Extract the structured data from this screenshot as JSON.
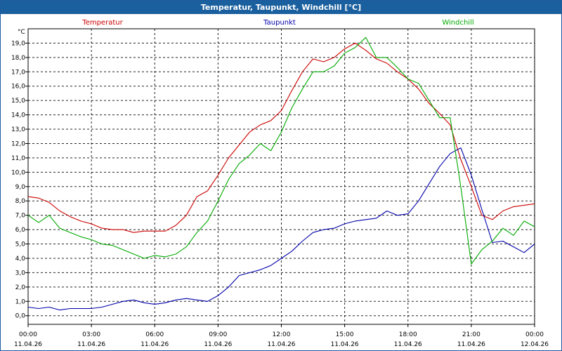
{
  "window": {
    "title": "Temperatur, Taupunkt, Windchill [°C]"
  },
  "colors": {
    "temperatur": "#cc0000",
    "taupunkt": "#0000aa",
    "windchill": "#00aa00",
    "titlebar": "#1a5f9e"
  },
  "chart_data": {
    "type": "line",
    "title": "Temperatur, Taupunkt, Windchill [°C]",
    "ylabel": "°C",
    "ylim": [
      -0.6,
      20.0
    ],
    "xlim": [
      "11.04.26 00:00",
      "12.04.26 00:00"
    ],
    "grid": true,
    "legend_placement": "top",
    "y_ticks": [
      "0,0",
      "1,0",
      "2,0",
      "3,0",
      "4,0",
      "5,0",
      "6,0",
      "7,0",
      "8,0",
      "9,0",
      "10,0",
      "11,0",
      "12,0",
      "13,0",
      "14,0",
      "15,0",
      "16,0",
      "17,0",
      "18,0",
      "19,0"
    ],
    "x_ticks": [
      {
        "time": "00:00",
        "date": "11.04.26"
      },
      {
        "time": "03:00",
        "date": "11.04.26"
      },
      {
        "time": "06:00",
        "date": "11.04.26"
      },
      {
        "time": "09:00",
        "date": "11.04.26"
      },
      {
        "time": "12:00",
        "date": "11.04.26"
      },
      {
        "time": "15:00",
        "date": "11.04.26"
      },
      {
        "time": "18:00",
        "date": "11.04.26"
      },
      {
        "time": "21:00",
        "date": "11.04.26"
      },
      {
        "time": "00:00",
        "date": "12.04.26"
      }
    ],
    "x": [
      "00:00",
      "00:30",
      "01:00",
      "01:30",
      "02:00",
      "02:30",
      "03:00",
      "03:30",
      "04:00",
      "04:30",
      "05:00",
      "05:30",
      "06:00",
      "06:30",
      "07:00",
      "07:30",
      "08:00",
      "08:30",
      "09:00",
      "09:30",
      "10:00",
      "10:30",
      "11:00",
      "11:30",
      "12:00",
      "12:30",
      "13:00",
      "13:30",
      "14:00",
      "14:30",
      "15:00",
      "15:30",
      "16:00",
      "16:30",
      "17:00",
      "17:30",
      "18:00",
      "18:30",
      "19:00",
      "19:30",
      "20:00",
      "20:30",
      "21:00",
      "21:30",
      "22:00",
      "22:30",
      "23:00",
      "23:30",
      "00:00"
    ],
    "series": [
      {
        "name": "Temperatur",
        "color": "#cc0000",
        "values": [
          8.3,
          8.2,
          7.9,
          7.3,
          6.9,
          6.6,
          6.4,
          6.1,
          6.0,
          6.0,
          5.8,
          5.9,
          5.9,
          5.9,
          6.3,
          7.0,
          8.3,
          8.7,
          9.8,
          11.0,
          11.9,
          12.8,
          13.3,
          13.6,
          14.3,
          15.7,
          17.0,
          17.9,
          17.7,
          18.0,
          18.6,
          19.0,
          18.5,
          17.9,
          17.6,
          17.0,
          16.5,
          15.8,
          14.8,
          14.1,
          13.3,
          10.9,
          9.0,
          7.0,
          6.7,
          7.3,
          7.6,
          7.7,
          7.8
        ]
      },
      {
        "name": "Taupunkt",
        "color": "#0000aa",
        "values": [
          0.6,
          0.5,
          0.6,
          0.4,
          0.5,
          0.5,
          0.5,
          0.6,
          0.8,
          1.0,
          1.1,
          0.9,
          0.8,
          0.9,
          1.1,
          1.2,
          1.1,
          1.0,
          1.4,
          2.0,
          2.8,
          3.0,
          3.2,
          3.5,
          4.0,
          4.5,
          5.2,
          5.8,
          6.0,
          6.1,
          6.4,
          6.6,
          6.7,
          6.8,
          7.3,
          7.0,
          7.1,
          8.0,
          9.2,
          10.4,
          11.3,
          11.7,
          9.8,
          7.4,
          5.1,
          5.2,
          4.8,
          4.4,
          5.0
        ]
      },
      {
        "name": "Windchill",
        "color": "#00aa00",
        "values": [
          7.0,
          6.5,
          7.0,
          6.1,
          5.8,
          5.5,
          5.3,
          5.0,
          4.9,
          4.6,
          4.3,
          4.0,
          4.2,
          4.1,
          4.3,
          4.8,
          5.8,
          6.6,
          8.0,
          9.5,
          10.6,
          11.2,
          12.0,
          11.5,
          12.8,
          14.5,
          15.8,
          17.0,
          17.0,
          17.4,
          18.3,
          18.7,
          19.4,
          18.0,
          18.0,
          17.3,
          16.5,
          16.2,
          15.0,
          13.8,
          13.8,
          9.0,
          3.6,
          4.6,
          5.2,
          6.1,
          5.6,
          6.6,
          6.2
        ]
      }
    ]
  }
}
